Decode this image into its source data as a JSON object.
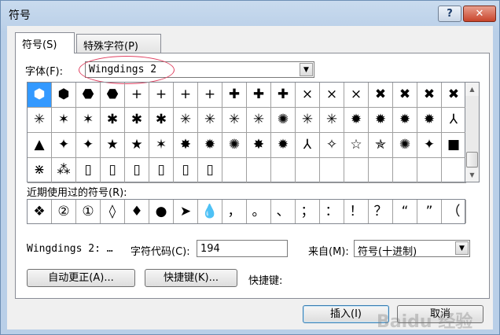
{
  "window": {
    "title": "符号",
    "help_label": "?",
    "close_label": "✕"
  },
  "tabs": [
    {
      "label": "符号(S)",
      "active": true
    },
    {
      "label": "特殊字符(P)",
      "active": false
    }
  ],
  "font": {
    "label": "字体(F):",
    "value": "Wingdings 2"
  },
  "symbol_grid": {
    "rows": [
      [
        "⬢",
        "⬢",
        "⬣",
        "⬣",
        "+",
        "+",
        "+",
        "+",
        "✚",
        "✚",
        "✚",
        "×",
        "×",
        "×",
        "✖",
        "✖",
        "✖",
        "✖"
      ],
      [
        "✳",
        "✶",
        "✶",
        "✱",
        "✱",
        "✱",
        "✳",
        "✳",
        "✳",
        "✳",
        "✺",
        "✳",
        "✳",
        "✹",
        "✹",
        "✹",
        "✹",
        "⅄"
      ],
      [
        "▲",
        "✦",
        "✦",
        "★",
        "★",
        "✶",
        "✸",
        "✹",
        "✺",
        "✸",
        "✹",
        "⅄",
        "✧",
        "☆",
        "✯",
        "✺",
        "✦",
        "■"
      ],
      [
        "⋇",
        "⁂",
        "▯",
        "▯",
        "▯",
        "▯",
        "▯",
        "▯",
        "",
        "",
        "",
        "",
        "",
        "",
        "",
        "",
        "",
        ""
      ]
    ],
    "selected": "0,0"
  },
  "recent": {
    "label": "近期使用过的符号(R):",
    "cells": [
      "❖",
      "②",
      "①",
      "◊",
      "♦",
      "●",
      "➤",
      "💧",
      "，",
      "。",
      "、",
      "；",
      "：",
      "！",
      "？",
      "“",
      "”",
      "（"
    ]
  },
  "footer": {
    "char_name": "Wingdings 2: …",
    "code_label": "字符代码(C):",
    "code_value": "194",
    "from_label": "来自(M):",
    "from_value": "符号(十进制)"
  },
  "buttons": {
    "autocorrect": "自动更正(A)...",
    "shortcut_key": "快捷键(K)...",
    "shortcut_label": "快捷键:",
    "insert": "插入(I)",
    "cancel": "取消"
  },
  "watermark": "Baidu 经验"
}
